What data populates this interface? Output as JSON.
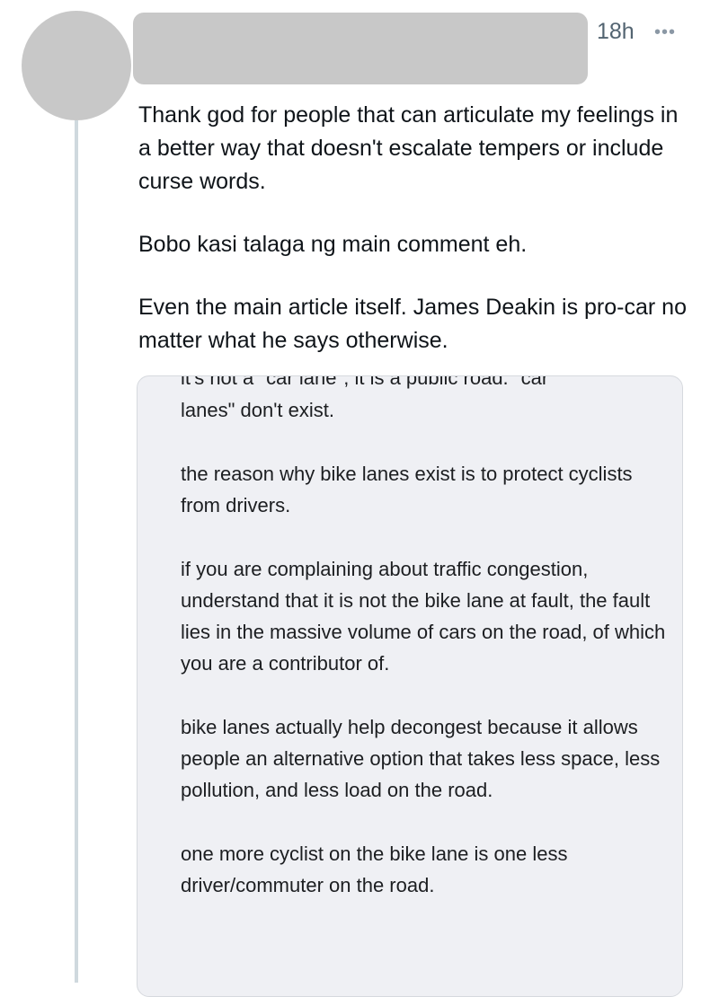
{
  "tweet": {
    "timestamp": "18h",
    "more_glyph": "•••",
    "paragraphs": [
      "Thank god for people that can articulate my feelings in a better way that doesn't escalate tempers or include curse words.",
      "Bobo kasi talaga ng main comment eh.",
      "Even the main article itself. James Deakin is pro-car no matter what he says otherwise."
    ]
  },
  "embed": {
    "cut_line": "it's not a \"car lane\", it is a public road. \"car",
    "paragraphs": [
      "lanes\" don't exist.",
      "the reason why bike lanes exist is to protect cyclists from drivers.",
      "if you are complaining about traffic congestion, understand that it is not the bike lane at fault, the fault lies in the massive volume of cars on the road, of which you are a contributor of.",
      "bike lanes actually help decongest because it allows people an alternative option that takes less space, less pollution, and less load on the road.",
      "one more cyclist on the bike lane is one less driver/commuter on the road."
    ]
  }
}
